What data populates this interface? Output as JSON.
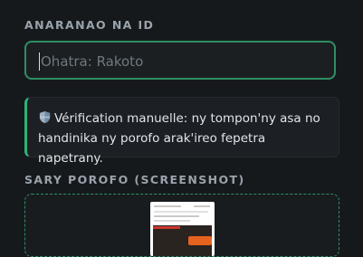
{
  "form": {
    "id_label": "ANARANAO NA ID",
    "id_placeholder": "Ohatra: Rakoto",
    "notice_text": "Vérification manuelle: ny tompon'ny asa no handinika ny porofo arak'ireo fepetra napetrany.",
    "notice_icon": "shield-icon",
    "screenshot_label": "SARY POROFO (SCREENSHOT)"
  },
  "colors": {
    "background": "#16191c",
    "accent": "#2e8f64",
    "accent_bright": "#2fb37a"
  }
}
